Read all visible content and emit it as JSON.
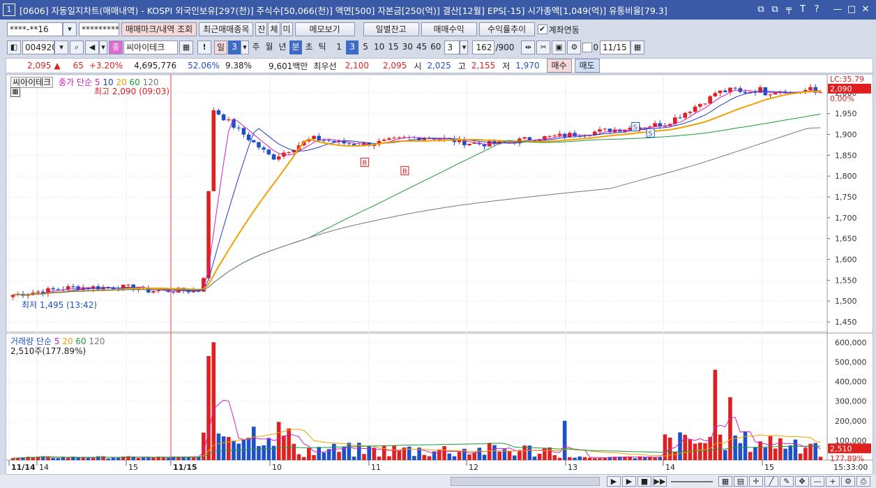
{
  "titlebar": {
    "num": "1",
    "text": "[0606] 자동일지차트(매매내역) - KOSPI 외국인보유[297(천)] 주식수[50,066(천)] 액면[500] 자본금[250(억)] 결산[12월] EPS[-15] 시가총액[1,049(억)] 유통비율[79.3]",
    "buttons": [
      "⧉",
      "⧉",
      "╤",
      "T",
      "?",
      "—",
      "□",
      "✕"
    ]
  },
  "toolbar1": {
    "account": "****-**16",
    "password": "*********",
    "btn_mark": "매매마크/내역 조회",
    "btn_recent": "최근매매종목",
    "tabs": [
      "잔",
      "체",
      "미"
    ],
    "btn_memo": "메모보기",
    "btn_daily": "일별잔고",
    "btn_profit": "매매수익",
    "btn_rate": "수익률추이",
    "link_label": "계좌연동"
  },
  "toolbar2": {
    "code": "004920",
    "stock_name": "씨아이테크",
    "periods": [
      "일",
      "3",
      "주",
      "월",
      "년",
      "분",
      "초",
      "틱"
    ],
    "minutes": [
      "1",
      "3",
      "5",
      "10",
      "15",
      "30",
      "45",
      "60"
    ],
    "count": "3",
    "range": "162",
    "range_total": "/900",
    "zero_label": "0",
    "date": "11/15"
  },
  "quote": {
    "price": "2,095",
    "change": "65",
    "pct": "+3.20%",
    "volume": "4,695,776",
    "ratio1": "52.06%",
    "ratio2": "9.38%",
    "amount": "9,601백만",
    "bid_label": "최우선",
    "bid1": "2,100",
    "bid2": "2,095",
    "open_label": "시",
    "open": "2,025",
    "high_label": "고",
    "high": "2,155",
    "low_label": "저",
    "low": "1,970",
    "buy": "매수",
    "sell": "매도"
  },
  "legend": {
    "name": "씨아이테크",
    "price_label": "종가 단순",
    "ma": [
      "5",
      "10",
      "20",
      "60",
      "120"
    ],
    "high_note": "최고 2,090 (09:03)",
    "low_note": "최저 1,495 (13:42)",
    "vol_label": "거래량 단순",
    "vol_ma": [
      "5",
      "20",
      "60",
      "120"
    ],
    "vol_value": "2,510주(177.89%)"
  },
  "price_axis": [
    "2,000",
    "1,950",
    "1,900",
    "1,850",
    "1,800",
    "1,750",
    "1,700",
    "1,650",
    "1,600",
    "1,550",
    "1,500",
    "1,450"
  ],
  "price_tags": {
    "top": "LC:35.79",
    "current": "2,090",
    "pct": "0.00%"
  },
  "vol_axis": [
    "600,000",
    "500,000",
    "400,000",
    "300,000",
    "200,000",
    "100,000"
  ],
  "vol_tags": {
    "current": "2,510",
    "pct": "177.89%"
  },
  "time_axis": [
    {
      "label": "11/14",
      "bold": true
    },
    {
      "label": "14"
    },
    {
      "label": "15"
    },
    {
      "label": "11/15",
      "bold": true
    },
    {
      "label": "10"
    },
    {
      "label": "11"
    },
    {
      "label": "12"
    },
    {
      "label": "13"
    },
    {
      "label": "14"
    },
    {
      "label": "15"
    }
  ],
  "time_now": "15:33:00",
  "colors": {
    "up": "#e02020",
    "down": "#1e50c8",
    "ma5": "#d020c0",
    "ma10": "#1e3cc8",
    "ma20": "#f0a000",
    "ma60": "#1a9a3a",
    "ma120": "#777777"
  },
  "chart_data": {
    "type": "candlestick",
    "series_price_ticks": [
      "1,450",
      "1,500",
      "1,550",
      "1,600",
      "1,650",
      "1,700",
      "1,750",
      "1,800",
      "1,850",
      "1,900",
      "1,950",
      "2,000"
    ],
    "high": 2090,
    "low": 1495,
    "last": 2095,
    "volume_last": 2510
  }
}
